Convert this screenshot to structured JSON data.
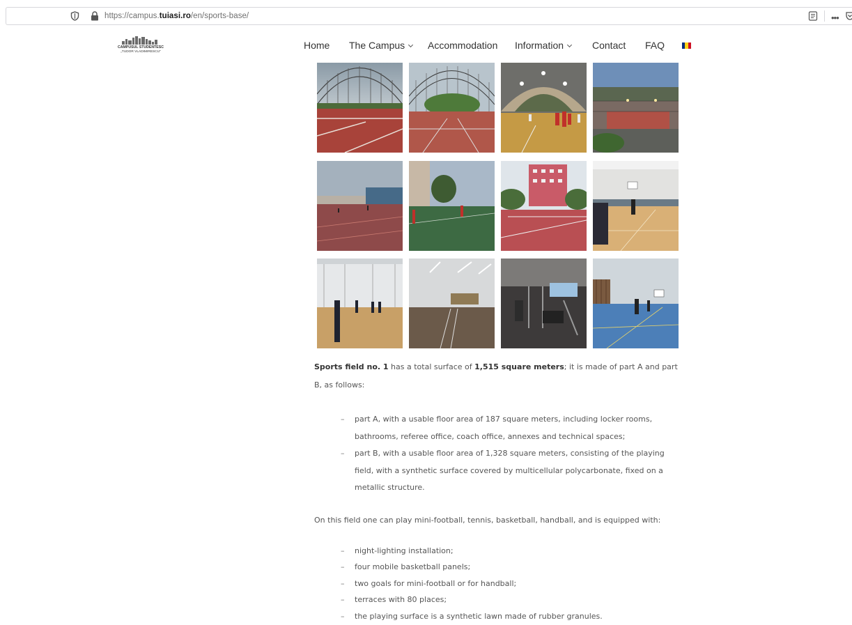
{
  "browser": {
    "url_prefix": "https://campus.",
    "url_domain": "tuiasi.ro",
    "url_path": "/en/sports-base/"
  },
  "site": {
    "logo_line1": "CAMPUSUL STUDENTESC",
    "logo_line2": "„TUDOR VLADIMIRESCU”",
    "nav": [
      {
        "label": "Home",
        "has_dropdown": false
      },
      {
        "label": "The Campus",
        "has_dropdown": true
      },
      {
        "label": "Accommodation",
        "has_dropdown": false
      },
      {
        "label": "Information",
        "has_dropdown": true
      },
      {
        "label": "Contact",
        "has_dropdown": false
      },
      {
        "label": "FAQ",
        "has_dropdown": false
      }
    ],
    "flag_colors": [
      "#002b7f",
      "#fcd116",
      "#ce1126"
    ]
  },
  "gallery": {
    "photos": [
      {
        "icon": "dome-tennis-court-photo"
      },
      {
        "icon": "dome-court-trees-photo"
      },
      {
        "icon": "dome-handball-night-photo"
      },
      {
        "icon": "outdoor-court-evening-photo"
      },
      {
        "icon": "outdoor-red-court-photo"
      },
      {
        "icon": "green-football-pitch-photo"
      },
      {
        "icon": "court-apartment-block-photo"
      },
      {
        "icon": "indoor-basketball-photo"
      },
      {
        "icon": "indoor-gym-players-photo"
      },
      {
        "icon": "empty-gym-hall-photo"
      },
      {
        "icon": "fitness-room-photo"
      },
      {
        "icon": "blue-floor-gym-photo"
      }
    ]
  },
  "article": {
    "p1_b1": "Sports field no. 1",
    "p1_t1": " has a total surface of ",
    "p1_b2": "1,515 square meters",
    "p1_t2": "; it is made of part A and part B, as follows:",
    "list1": [
      "part A, with a usable floor area of 187 square meters, including locker rooms, bathrooms, referee office, coach office, annexes and technical spaces;",
      "part B, with a usable floor area of 1,328 square meters, consisting of the playing field, with a synthetic surface covered by multicellular polycarbonate, fixed on a metallic structure."
    ],
    "p2": "On this field one can play mini-football, tennis, basketball, handball, and is equipped with:",
    "list2": [
      "night-lighting installation;",
      "four mobile basketball panels;",
      "two goals for mini-football or for handball;",
      "terraces with 80 places;",
      "the playing surface is a synthetic lawn made of rubber granules."
    ]
  }
}
